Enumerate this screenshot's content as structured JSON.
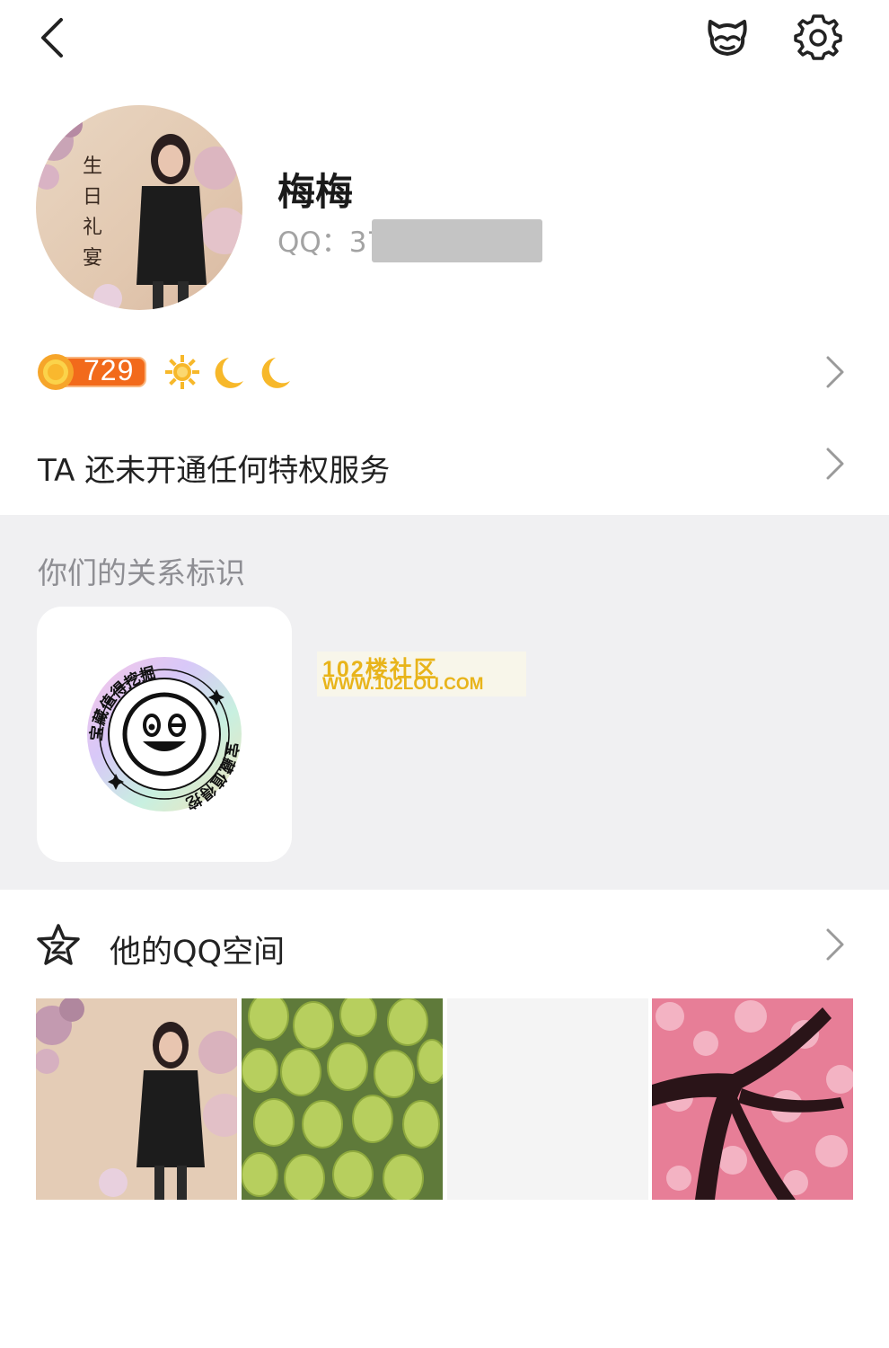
{
  "icons": {
    "back": "back-arrow-icon",
    "pet": "pet-icon",
    "settings": "gear-icon",
    "level_badge": "level-badge-icon",
    "sun": "sun-icon",
    "moon": "moon-icon",
    "chevron": "chevron-right-icon",
    "zone": "star-icon"
  },
  "profile": {
    "nickname": "梅梅",
    "qq_label": "QQ：37"
  },
  "level": {
    "value": "729"
  },
  "privilege": {
    "text": "TA 还未开通任何特权服务"
  },
  "relationship": {
    "title": "你们的关系标识",
    "badge_text": "宝藏值得挖掘"
  },
  "watermark": {
    "line1": "102楼社区",
    "line2": "WWW.102LOU.COM"
  },
  "qzone": {
    "label": "他的QQ空间"
  },
  "avatar_text": {
    "chars": [
      "生",
      "日",
      "礼",
      "宴"
    ]
  },
  "colors": {
    "section_bg": "#f0f0f2",
    "level_orange": "#f26a1b",
    "moon_yellow": "#f7b82a",
    "muted_text": "#8e8e93"
  }
}
